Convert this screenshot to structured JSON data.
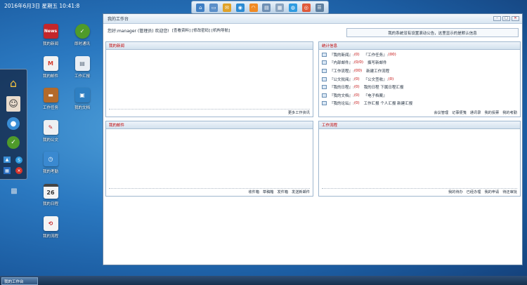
{
  "clock": "2016年6月3日 星期五 10:41:8",
  "launcher": [
    "home-icon",
    "window-icon",
    "mail-icon",
    "globe-icon",
    "rss-icon",
    "card-icon",
    "calendar-icon",
    "earth-icon",
    "help-icon",
    "list-icon"
  ],
  "desktop_icons": [
    {
      "label": "我的新闻",
      "icon": "news-icon",
      "color": "#c4262b",
      "text": "News"
    },
    {
      "label": "即时通讯",
      "icon": "chat-icon",
      "color": "#4f9b2a",
      "text": ""
    },
    {
      "label": "我的邮件",
      "icon": "gmail-icon",
      "color": "#f2f2f2",
      "text": "M"
    },
    {
      "label": "工作汇报",
      "icon": "report-icon",
      "color": "#e9eef4",
      "text": ""
    },
    {
      "label": "工作任务",
      "icon": "briefcase-icon",
      "color": "#b36a2a",
      "text": ""
    },
    {
      "label": "我的文档",
      "icon": "document-icon",
      "color": "#2e7fc2",
      "text": ""
    },
    {
      "label": "我的公文",
      "icon": "pen-icon",
      "color": "#eef0f2",
      "text": ""
    },
    {
      "label": "我的考勤",
      "icon": "clock-icon",
      "color": "#3a89d0",
      "text": ""
    },
    {
      "label": "我的日程",
      "icon": "calendar-26-icon",
      "color": "#f4f4f4",
      "text": "26"
    },
    {
      "label": "我的流程",
      "icon": "flow-icon",
      "color": "#f4f4f4",
      "text": ""
    }
  ],
  "window": {
    "title": "我的工作台",
    "controls": [
      "minimize",
      "maximize",
      "close"
    ],
    "greeting": "您好:manager (管理员) 欢迎您!",
    "nav": "[查看资料] [修改密码] [机构导航]",
    "notice": "我的系统没有设置滚动公告，这里显示的是默认信息"
  },
  "panels": {
    "news": {
      "title": "我的新闻",
      "footer": [
        "更多工作资讯"
      ]
    },
    "stats": {
      "title": "统计信息",
      "rows": [
        [
          {
            "t": "『我的新闻』:"
          },
          {
            "t": "(0)",
            "n": true
          },
          {
            "t": "『工作任务』:",
            "g": true
          },
          {
            "t": "(00)",
            "n": true
          }
        ],
        [
          {
            "t": "『内部邮件』:"
          },
          {
            "t": "(0/0)",
            "n": true
          },
          {
            "t": "撰写新邮件",
            "g": true
          }
        ],
        [
          {
            "t": "『工作流程』:"
          },
          {
            "t": "(00)",
            "n": true
          },
          {
            "t": "新建工作流程",
            "g": true
          }
        ],
        [
          {
            "t": "『公文批阅』:"
          },
          {
            "t": "(0)",
            "n": true
          },
          {
            "t": "『公文签收』:",
            "g": true
          },
          {
            "t": "(0)",
            "n": true
          }
        ],
        [
          {
            "t": "『我的日程』:"
          },
          {
            "t": "(0)",
            "n": true
          },
          {
            "t": "我的日程  下属日程汇报",
            "g": true
          }
        ],
        [
          {
            "t": "『我的文档』:"
          },
          {
            "t": "(0)",
            "n": true
          },
          {
            "t": "『电子档案』",
            "g": true
          }
        ],
        [
          {
            "t": "『我的论坛』:"
          },
          {
            "t": "(0)",
            "n": true
          },
          {
            "t": "工作汇报  个人汇报  新建汇报",
            "g": true
          }
        ]
      ],
      "footer": [
        "会议管理",
        "记事便笺",
        "通讯录",
        "我的投票",
        "我的考勤"
      ]
    },
    "mail": {
      "title": "我的邮件",
      "footer": [
        "收件箱",
        "草稿箱",
        "发件箱",
        "发送新邮件"
      ]
    },
    "flow": {
      "title": "工作流程",
      "footer": [
        "我的待办",
        "已经办理",
        "我的申请",
        "待还审批"
      ]
    }
  },
  "taskbar": {
    "item": "我的工作台"
  }
}
